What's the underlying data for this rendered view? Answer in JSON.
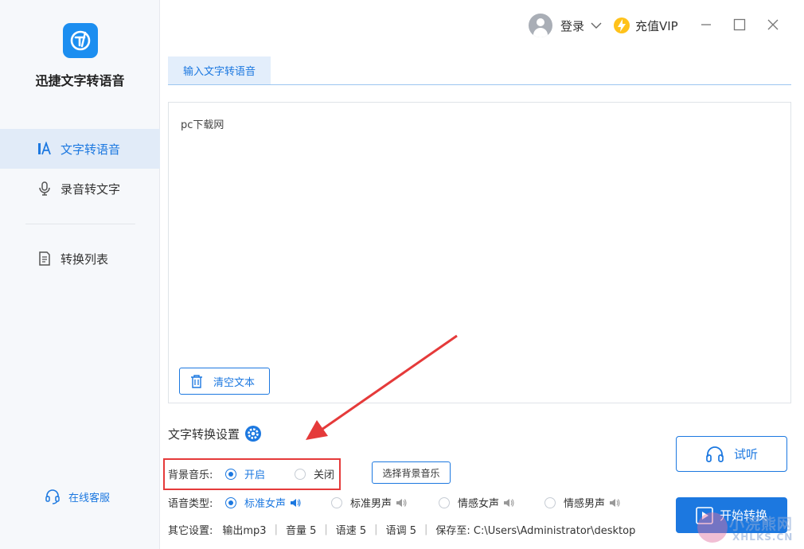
{
  "app": {
    "name": "迅捷文字转语音",
    "accent": "#1c78e0"
  },
  "sidebar": {
    "items": [
      {
        "label": "文字转语音",
        "icon": "text-to-speech-icon",
        "active": true
      },
      {
        "label": "录音转文字",
        "icon": "microphone-icon",
        "active": false
      },
      {
        "label": "转换列表",
        "icon": "conversion-list-icon",
        "active": false
      }
    ],
    "service_label": "在线客服"
  },
  "header": {
    "login_label": "登录",
    "vip_label": "充值VIP"
  },
  "tabs": [
    {
      "label": "输入文字转语音"
    }
  ],
  "editor": {
    "text": "pc下载网",
    "clear_label": "清空文本"
  },
  "settings": {
    "title": "文字转换设置",
    "bg_music": {
      "label": "背景音乐:",
      "options": [
        {
          "label": "开启",
          "selected": true
        },
        {
          "label": "关闭",
          "selected": false
        }
      ],
      "choose_label": "选择背景音乐"
    },
    "voice_type": {
      "label": "语音类型:",
      "options": [
        {
          "label": "标准女声",
          "selected": true
        },
        {
          "label": "标准男声",
          "selected": false
        },
        {
          "label": "情感女声",
          "selected": false
        },
        {
          "label": "情感男声",
          "selected": false
        }
      ]
    },
    "other": {
      "label": "其它设置:",
      "output": "输出mp3",
      "volume": "音量 5",
      "speed": "语速 5",
      "pitch": "语调 5",
      "save_path": "保存至: C:\\Users\\Administrator\\desktop"
    }
  },
  "actions": {
    "listen_label": "试听",
    "start_label": "开始转换"
  },
  "watermark": {
    "text": "小浣熊网",
    "sub": "XHLKS.CN"
  }
}
